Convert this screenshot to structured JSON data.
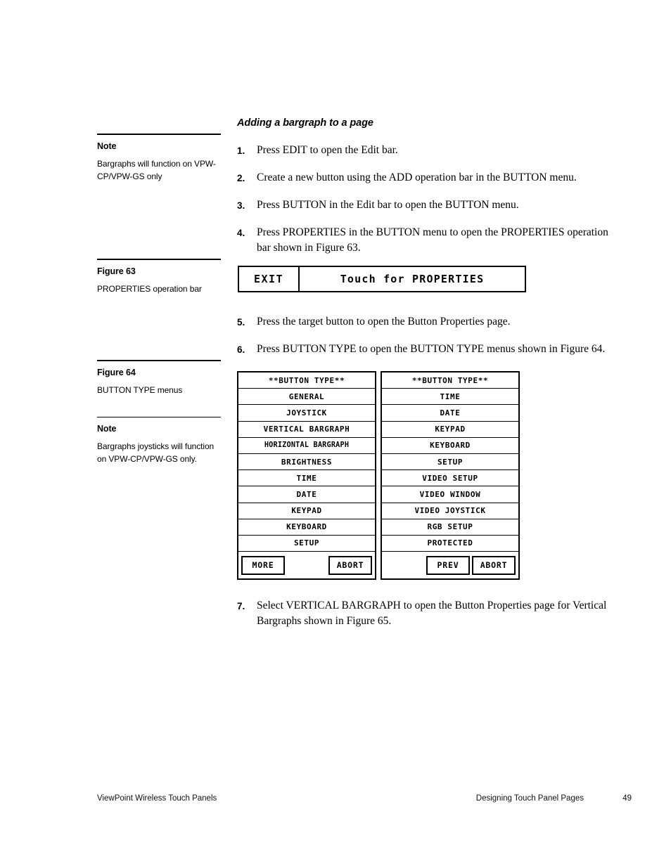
{
  "page": {
    "heading": "Adding a bargraph to a page"
  },
  "sidebar": {
    "note1": {
      "title": "Note",
      "text": "Bargraphs will function on VPW-CP/VPW-GS only"
    },
    "figure63": {
      "title": "Figure 63",
      "caption": "PROPERTIES operation bar"
    },
    "figure64": {
      "title": "Figure 64",
      "caption": "BUTTON TYPE menus"
    },
    "note2": {
      "title": "Note",
      "text": "Bargraphs joysticks will function on VPW-CP/VPW-GS only."
    }
  },
  "steps": [
    {
      "num": "1.",
      "text": "Press EDIT to open the Edit bar."
    },
    {
      "num": "2.",
      "text": "Create a new button using the ADD operation bar in the BUTTON menu."
    },
    {
      "num": "3.",
      "text": "Press BUTTON in the Edit bar to open the BUTTON menu."
    },
    {
      "num": "4.",
      "text": "Press PROPERTIES in the BUTTON menu to open the PROPERTIES operation bar shown in Figure 63."
    },
    {
      "num": "5.",
      "text": "Press the target button to open the Button Properties page."
    },
    {
      "num": "6.",
      "text": "Press BUTTON TYPE to open the BUTTON TYPE menus shown in Figure 64."
    },
    {
      "num": "7.",
      "text": "Select VERTICAL BARGRAPH to open the Button Properties page for Vertical Bargraphs shown in Figure 65."
    }
  ],
  "figure63_bar": {
    "exit_label": "EXIT",
    "touch_label": "Touch for PROPERTIES"
  },
  "figure64_menus": {
    "left": {
      "header": "**BUTTON TYPE**",
      "items": [
        "GENERAL",
        "JOYSTICK",
        "VERTICAL BARGRAPH",
        "HORIZONTAL BARGRAPH",
        "BRIGHTNESS",
        "TIME",
        "DATE",
        "KEYPAD",
        "KEYBOARD",
        "SETUP"
      ],
      "buttons": [
        "MORE",
        "ABORT"
      ]
    },
    "right": {
      "header": "**BUTTON TYPE**",
      "items": [
        "TIME",
        "DATE",
        "KEYPAD",
        "KEYBOARD",
        "SETUP",
        "VIDEO SETUP",
        "VIDEO WINDOW",
        "VIDEO JOYSTICK",
        "RGB SETUP",
        "PROTECTED"
      ],
      "buttons": [
        "PREV",
        "ABORT"
      ]
    }
  },
  "footer": {
    "left": "ViewPoint Wireless Touch Panels",
    "right": "Designing Touch Panel Pages",
    "page": "49"
  }
}
